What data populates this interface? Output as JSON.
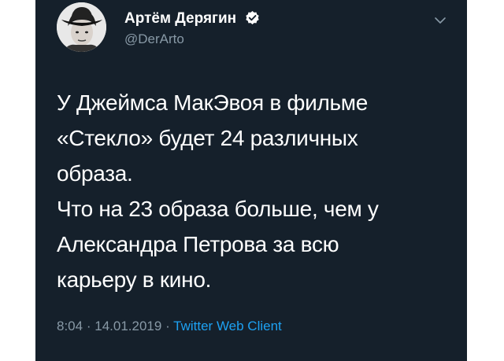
{
  "tweet": {
    "author_name": "Артём Дерягин",
    "author_handle": "@DerArto",
    "text_lines": [
      "У Джеймса МакЭвоя в фильме",
      "«Стекло» будет 24 различных",
      "образа.",
      "Что на 23 образа больше, чем у",
      "Александра Петрова за всю",
      "карьеру в кино."
    ],
    "time": "8:04",
    "date": "14.01.2019",
    "separator": "·",
    "source": "Twitter Web Client"
  },
  "icons": {
    "verified": "verified-badge-icon",
    "chevron": "chevron-down-icon"
  },
  "colors": {
    "background": "#15202b",
    "text": "#ffffff",
    "secondary": "#8899a6",
    "link": "#1da1f2"
  }
}
